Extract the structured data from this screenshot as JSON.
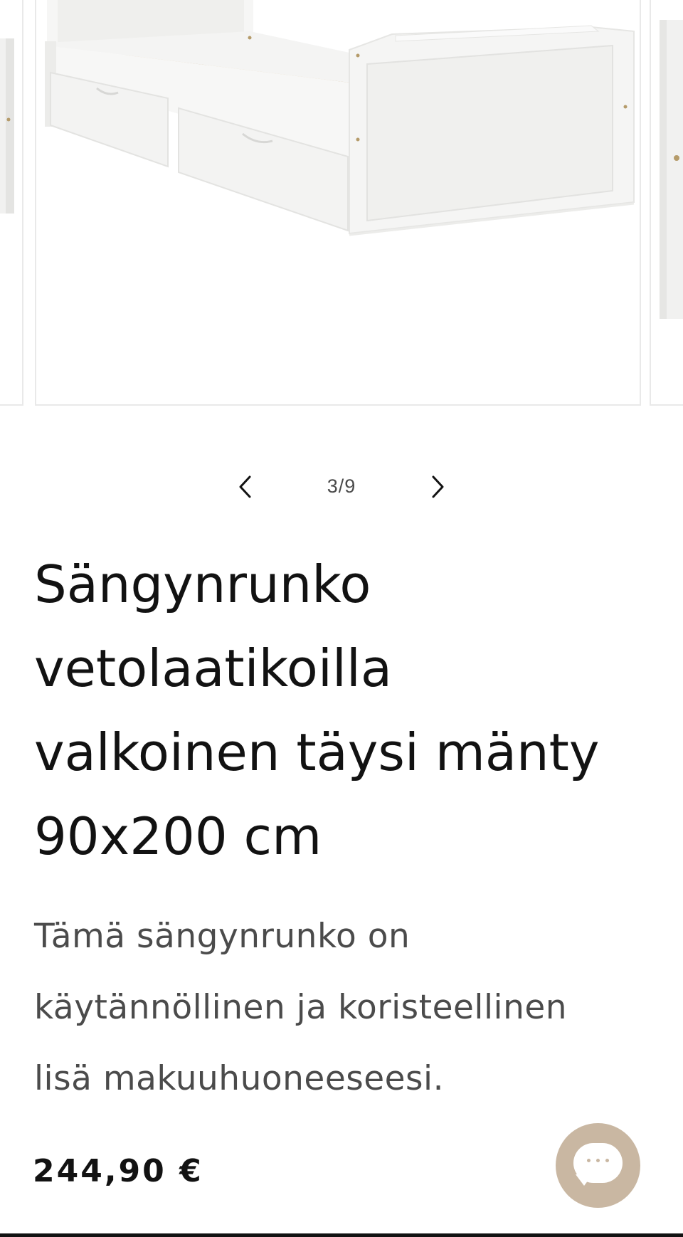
{
  "gallery": {
    "counter_current": "3",
    "counter_separator": "/",
    "counter_total": "9",
    "prev_icon": "chevron-left-icon",
    "next_icon": "chevron-right-icon"
  },
  "product": {
    "title_lines": [
      "Sängynrunko",
      "vetolaatikoilla",
      "valkoinen täysi mänty",
      "90x200 cm"
    ],
    "description_lines": [
      "Tämä sängynrunko on",
      "käytännöllinen ja koristeellinen",
      "lisä makuuhuoneeseesi."
    ],
    "price": "244,90 €"
  },
  "chat": {
    "icon": "chat-bubble-icon"
  },
  "colors": {
    "text": "#121212",
    "secondary_text": "#4b4b4b",
    "chat_button": "#c9b7a2",
    "border": "#e9e9e9"
  }
}
